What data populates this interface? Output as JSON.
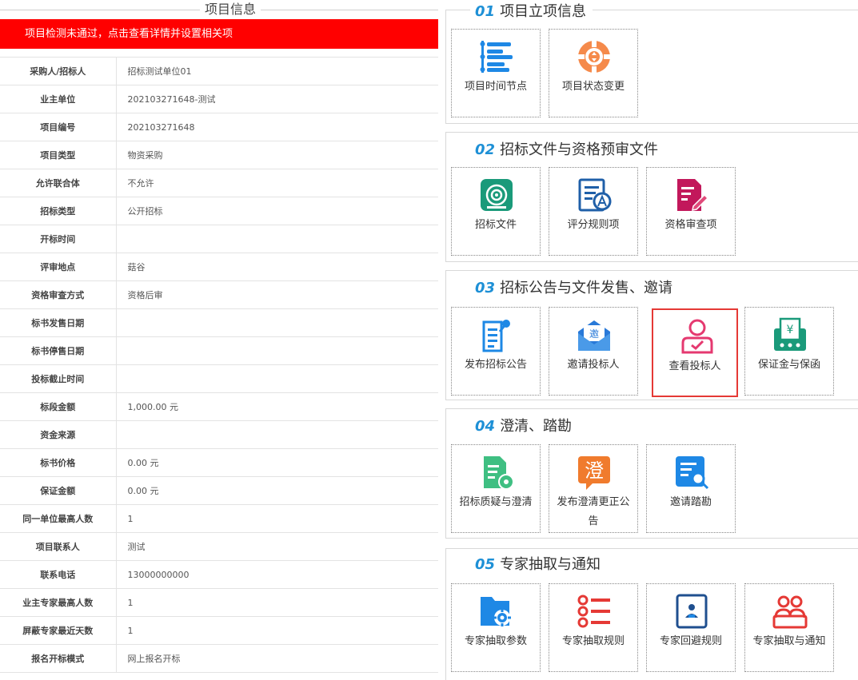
{
  "left": {
    "title": "项目信息",
    "alert": "项目检测未通过，点击查看详情并设置相关项",
    "rows": [
      {
        "label": "采购人/招标人",
        "value": "招标测试单位01"
      },
      {
        "label": "业主单位",
        "value": "202103271648-测试"
      },
      {
        "label": "项目编号",
        "value": "202103271648"
      },
      {
        "label": "项目类型",
        "value": "物资采购"
      },
      {
        "label": "允许联合体",
        "value": "不允许"
      },
      {
        "label": "招标类型",
        "value": "公开招标"
      },
      {
        "label": "开标时间",
        "value": ""
      },
      {
        "label": "评审地点",
        "value": "菇谷"
      },
      {
        "label": "资格审查方式",
        "value": "资格后审"
      },
      {
        "label": "标书发售日期",
        "value": ""
      },
      {
        "label": "标书停售日期",
        "value": ""
      },
      {
        "label": "投标截止时间",
        "value": ""
      },
      {
        "label": "标段金额",
        "value": "1,000.00 元"
      },
      {
        "label": "资金来源",
        "value": ""
      },
      {
        "label": "标书价格",
        "value": "0.00 元"
      },
      {
        "label": "保证金额",
        "value": "0.00 元"
      },
      {
        "label": "同一单位最高人数",
        "value": "1"
      },
      {
        "label": "项目联系人",
        "value": "测试"
      },
      {
        "label": "联系电话",
        "value": "13000000000"
      },
      {
        "label": "业主专家最高人数",
        "value": "1"
      },
      {
        "label": "屏蔽专家最近天数",
        "value": "1"
      },
      {
        "label": "报名开标模式",
        "value": "网上报名开标"
      }
    ]
  },
  "sections": [
    {
      "num": "01",
      "title": "项目立项信息",
      "cards": [
        {
          "label": "项目时间节点",
          "icon": "timeline-icon"
        },
        {
          "label": "项目状态变更",
          "icon": "status-change-icon"
        }
      ]
    },
    {
      "num": "02",
      "title": "招标文件与资格预审文件",
      "cards": [
        {
          "label": "招标文件",
          "icon": "tender-file-icon"
        },
        {
          "label": "评分规则项",
          "icon": "scoring-rules-icon"
        },
        {
          "label": "资格审查项",
          "icon": "qualification-review-icon"
        }
      ]
    },
    {
      "num": "03",
      "title": "招标公告与文件发售、邀请",
      "cards": [
        {
          "label": "发布招标公告",
          "icon": "publish-notice-icon"
        },
        {
          "label": "邀请投标人",
          "icon": "invite-bidder-icon"
        },
        {
          "label": "查看投标人",
          "icon": "view-bidder-icon",
          "active": true
        },
        {
          "label": "保证金与保函",
          "icon": "deposit-guarantee-icon"
        }
      ]
    },
    {
      "num": "04",
      "title": "澄清、踏勘",
      "cards": [
        {
          "label": "招标质疑与澄清",
          "icon": "query-clarify-icon"
        },
        {
          "label": "发布澄清更正公告",
          "icon": "clarify-notice-icon"
        },
        {
          "label": "邀请踏勘",
          "icon": "site-survey-icon"
        }
      ]
    },
    {
      "num": "05",
      "title": "专家抽取与通知",
      "cards": [
        {
          "label": "专家抽取参数",
          "icon": "expert-params-icon"
        },
        {
          "label": "专家抽取规则",
          "icon": "expert-rules-icon"
        },
        {
          "label": "专家回避规则",
          "icon": "expert-avoid-icon"
        },
        {
          "label": "专家抽取与通知",
          "icon": "expert-notify-icon"
        }
      ]
    }
  ],
  "colors": {
    "alert": "#ff0000",
    "accent_num": "#1e90d6",
    "active_border": "#e53935"
  }
}
